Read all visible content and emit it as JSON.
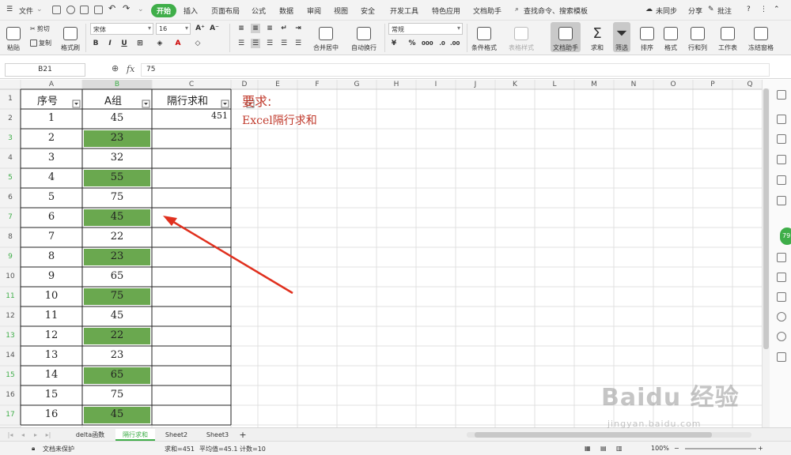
{
  "menubar": {
    "hamburger_label": "文件",
    "tabs": [
      "开始",
      "插入",
      "页面布局",
      "公式",
      "数据",
      "审阅",
      "视图",
      "安全",
      "开发工具",
      "特色应用",
      "文档助手"
    ],
    "search": "查找命令、搜索模板",
    "sync": "未同步",
    "share": "分享",
    "comment": "批注"
  },
  "toolbar": {
    "paste": "粘贴",
    "cut": "剪切",
    "copy": "复制",
    "format_painter": "格式刷",
    "font_name": "宋体",
    "font_size": "16",
    "bold": "B",
    "italic": "I",
    "underline": "U",
    "merge_center": "合并居中",
    "wrap_text": "自动换行",
    "number_format": "常规",
    "currency": "¥",
    "percent": "%",
    "conditional_format": "条件格式",
    "table_style": "表格样式",
    "doc_assistant": "文档助手",
    "sum": "求和",
    "filter": "筛选",
    "sort": "排序",
    "format": "格式",
    "row_col": "行和列",
    "worksheet": "工作表",
    "freeze": "冻结窗格"
  },
  "formula_bar": {
    "cell_ref": "B21",
    "fx": "fx",
    "value": "75"
  },
  "grid": {
    "columns": [
      "A",
      "B",
      "C",
      "D",
      "E",
      "F",
      "G",
      "H",
      "I",
      "J",
      "K",
      "L",
      "M",
      "N",
      "O",
      "P",
      "Q"
    ],
    "row_numbers": [
      "1",
      "2",
      "3",
      "4",
      "5",
      "6",
      "7",
      "8",
      "9",
      "10",
      "11",
      "12",
      "13",
      "14",
      "15",
      "16",
      "17"
    ],
    "header_row": [
      "序号",
      "A组",
      "隔行求和"
    ],
    "rows": [
      {
        "a": "1",
        "b": "45",
        "c": "451",
        "highlight": false
      },
      {
        "a": "2",
        "b": "23",
        "c": "",
        "highlight": true
      },
      {
        "a": "3",
        "b": "32",
        "c": "",
        "highlight": false
      },
      {
        "a": "4",
        "b": "55",
        "c": "",
        "highlight": true
      },
      {
        "a": "5",
        "b": "75",
        "c": "",
        "highlight": false
      },
      {
        "a": "6",
        "b": "45",
        "c": "",
        "highlight": true
      },
      {
        "a": "7",
        "b": "22",
        "c": "",
        "highlight": false
      },
      {
        "a": "8",
        "b": "23",
        "c": "",
        "highlight": true
      },
      {
        "a": "9",
        "b": "65",
        "c": "",
        "highlight": false
      },
      {
        "a": "10",
        "b": "75",
        "c": "",
        "highlight": true
      },
      {
        "a": "11",
        "b": "45",
        "c": "",
        "highlight": false
      },
      {
        "a": "12",
        "b": "22",
        "c": "",
        "highlight": true
      },
      {
        "a": "13",
        "b": "23",
        "c": "",
        "highlight": false
      },
      {
        "a": "14",
        "b": "65",
        "c": "",
        "highlight": true
      },
      {
        "a": "15",
        "b": "75",
        "c": "",
        "highlight": false
      },
      {
        "a": "16",
        "b": "45",
        "c": "",
        "highlight": true
      }
    ],
    "note_title": "要求:",
    "note_text": "Excel隔行求和",
    "highlight_color": "#6aa84f",
    "note_color": "#c0392b",
    "arrow_color": "#e0301e"
  },
  "sheet_tabs": [
    "delta函数",
    "隔行求和",
    "Sheet2",
    "Sheet3"
  ],
  "active_sheet": "隔行求和",
  "status": {
    "protect": "文档未保护",
    "sum": "求和=451",
    "avg": "平均值=45.1",
    "count": "计数=10",
    "zoom": "100%"
  },
  "badge": "79",
  "watermark": {
    "big": "Baidu 经验",
    "small": "jingyan.baidu.com"
  },
  "icons": [
    "menu-icon",
    "save-icon",
    "print-icon",
    "undo-icon",
    "redo-icon",
    "search-icon",
    "zoom-icon",
    "filter-icon",
    "sum-icon",
    "help-icon",
    "more-icon",
    "plus-icon"
  ]
}
